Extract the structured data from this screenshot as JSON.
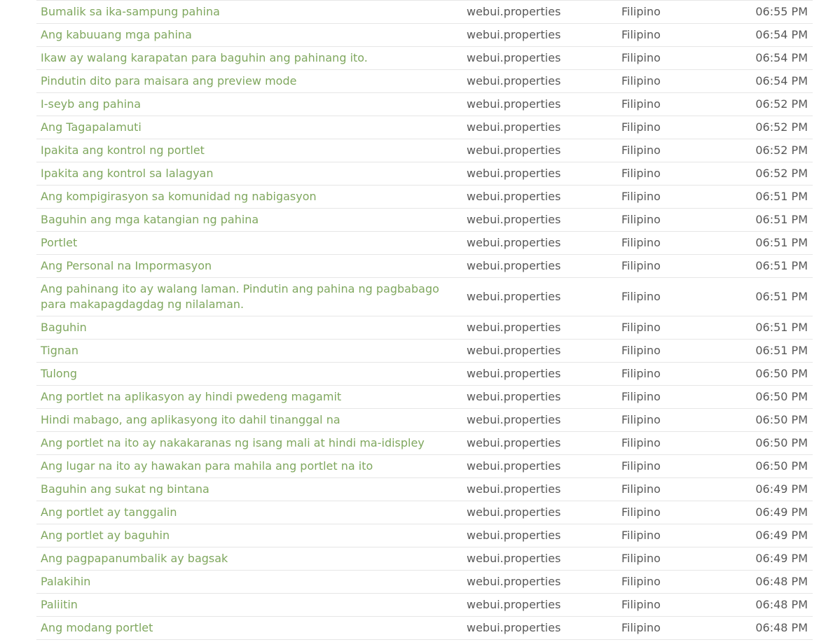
{
  "rows": [
    {
      "key": "Bumalik sa ika-sampung pahina",
      "file": "webui.properties",
      "language": "Filipino",
      "time": "06:55 PM"
    },
    {
      "key": "Ang kabuuang mga pahina",
      "file": "webui.properties",
      "language": "Filipino",
      "time": "06:54 PM"
    },
    {
      "key": "Ikaw ay walang karapatan para baguhin ang pahinang ito.",
      "file": "webui.properties",
      "language": "Filipino",
      "time": "06:54 PM"
    },
    {
      "key": "Pindutin dito para maisara ang preview mode",
      "file": "webui.properties",
      "language": "Filipino",
      "time": "06:54 PM"
    },
    {
      "key": "I-seyb ang pahina",
      "file": "webui.properties",
      "language": "Filipino",
      "time": "06:52 PM"
    },
    {
      "key": "Ang Tagapalamuti",
      "file": "webui.properties",
      "language": "Filipino",
      "time": "06:52 PM"
    },
    {
      "key": "Ipakita ang kontrol ng portlet",
      "file": "webui.properties",
      "language": "Filipino",
      "time": "06:52 PM"
    },
    {
      "key": "Ipakita ang kontrol sa lalagyan",
      "file": "webui.properties",
      "language": "Filipino",
      "time": "06:52 PM"
    },
    {
      "key": "Ang kompigirasyon sa komunidad ng nabigasyon",
      "file": "webui.properties",
      "language": "Filipino",
      "time": "06:51 PM"
    },
    {
      "key": "Baguhin ang mga katangian ng pahina",
      "file": "webui.properties",
      "language": "Filipino",
      "time": "06:51 PM"
    },
    {
      "key": "Portlet",
      "file": "webui.properties",
      "language": "Filipino",
      "time": "06:51 PM"
    },
    {
      "key": "Ang Personal na Impormasyon",
      "file": "webui.properties",
      "language": "Filipino",
      "time": "06:51 PM"
    },
    {
      "key": "Ang pahinang ito ay walang laman. Pindutin ang pahina ng pagbabago para makapagdagdag ng nilalaman.",
      "file": "webui.properties",
      "language": "Filipino",
      "time": "06:51 PM"
    },
    {
      "key": "Baguhin",
      "file": "webui.properties",
      "language": "Filipino",
      "time": "06:51 PM"
    },
    {
      "key": "Tignan",
      "file": "webui.properties",
      "language": "Filipino",
      "time": "06:51 PM"
    },
    {
      "key": "Tulong",
      "file": "webui.properties",
      "language": "Filipino",
      "time": "06:50 PM"
    },
    {
      "key": "Ang portlet na aplikasyon ay hindi pwedeng magamit",
      "file": "webui.properties",
      "language": "Filipino",
      "time": "06:50 PM"
    },
    {
      "key": "Hindi mabago, ang aplikasyong ito dahil tinanggal na",
      "file": "webui.properties",
      "language": "Filipino",
      "time": "06:50 PM"
    },
    {
      "key": "Ang portlet na ito ay nakakaranas ng isang mali at hindi ma-idispley",
      "file": "webui.properties",
      "language": "Filipino",
      "time": "06:50 PM"
    },
    {
      "key": "Ang lugar na ito ay hawakan para mahila ang portlet na ito",
      "file": "webui.properties",
      "language": "Filipino",
      "time": "06:50 PM"
    },
    {
      "key": "Baguhin ang sukat ng bintana",
      "file": "webui.properties",
      "language": "Filipino",
      "time": "06:49 PM"
    },
    {
      "key": "Ang portlet ay tanggalin",
      "file": "webui.properties",
      "language": "Filipino",
      "time": "06:49 PM"
    },
    {
      "key": "Ang portlet ay baguhin",
      "file": "webui.properties",
      "language": "Filipino",
      "time": "06:49 PM"
    },
    {
      "key": "Ang pagpapanumbalik ay bagsak",
      "file": "webui.properties",
      "language": "Filipino",
      "time": "06:49 PM"
    },
    {
      "key": "Palakihin",
      "file": "webui.properties",
      "language": "Filipino",
      "time": "06:48 PM"
    },
    {
      "key": "Paliitin",
      "file": "webui.properties",
      "language": "Filipino",
      "time": "06:48 PM"
    },
    {
      "key": "Ang modang portlet",
      "file": "webui.properties",
      "language": "Filipino",
      "time": "06:48 PM"
    }
  ]
}
